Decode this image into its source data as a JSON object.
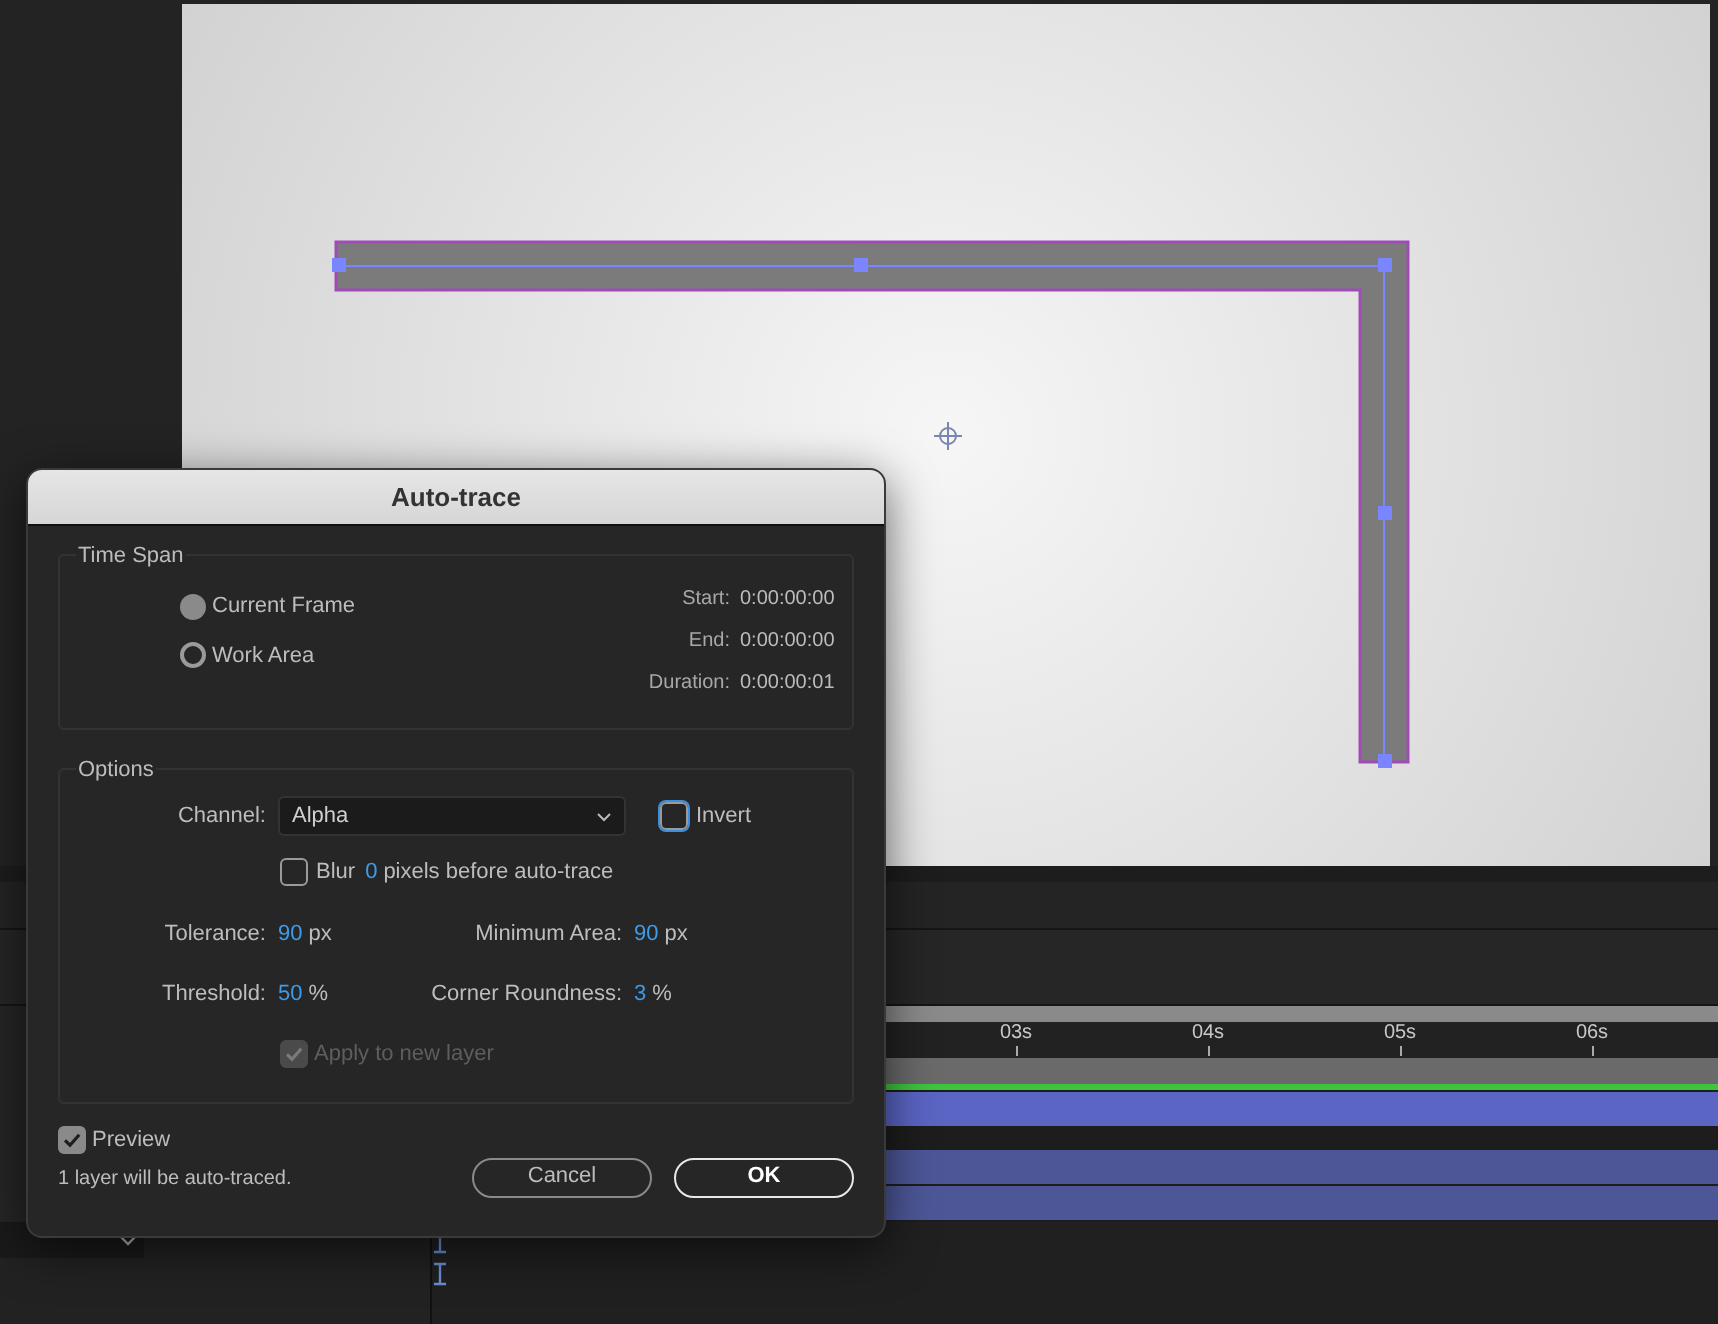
{
  "dialog": {
    "title": "Auto-trace",
    "time_span": {
      "legend": "Time Span",
      "options": [
        {
          "label": "Current Frame",
          "selected": true
        },
        {
          "label": "Work Area",
          "selected": false
        }
      ],
      "info": [
        {
          "label": "Start:",
          "value": "0:00:00:00"
        },
        {
          "label": "End:",
          "value": "0:00:00:00"
        },
        {
          "label": "Duration:",
          "value": "0:00:00:01"
        }
      ]
    },
    "options": {
      "legend": "Options",
      "channel": {
        "label": "Channel:",
        "value": "Alpha"
      },
      "invert": {
        "label": "Invert",
        "checked": false,
        "focused": true
      },
      "blur": {
        "label": "Blur",
        "checked": false,
        "value": "0",
        "suffix": "pixels before auto-trace"
      },
      "params": [
        {
          "label": "Tolerance:",
          "value": "90",
          "unit": "px"
        },
        {
          "label": "Minimum Area:",
          "value": "90",
          "unit": "px"
        },
        {
          "label": "Threshold:",
          "value": "50",
          "unit": "%"
        },
        {
          "label": "Corner Roundness:",
          "value": "3",
          "unit": "%"
        }
      ],
      "apply": {
        "label": "Apply to new layer",
        "checked": true,
        "disabled": true
      }
    },
    "preview": {
      "label": "Preview",
      "checked": true
    },
    "status": "1 layer will be auto-traced.",
    "buttons": [
      {
        "label": "Cancel",
        "kind": "secondary"
      },
      {
        "label": "OK",
        "kind": "primary"
      }
    ]
  },
  "timeline": {
    "ruler": [
      "03s",
      "04s",
      "05s",
      "06s"
    ]
  }
}
